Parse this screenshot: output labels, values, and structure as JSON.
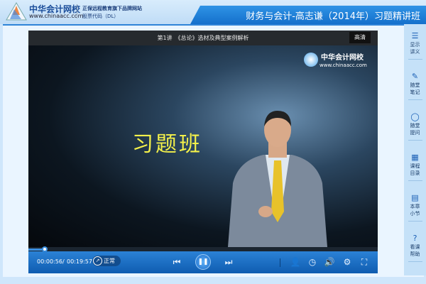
{
  "header": {
    "brand": "中华会计网校",
    "brand_url": "www.chinaacc.com",
    "slogan": "正保远程教育旗下品牌网站",
    "stock": "股票代码（DL）",
    "course_title": "财务与会计-高志谦（2014年）习题精讲班"
  },
  "video": {
    "lecture_title": "第1讲　《总论》选材及典型案例解析",
    "quality": "高清",
    "logo_text": "中华会计网校",
    "logo_url": "www.chinaacc.com",
    "slide_text": "习题班",
    "progress_fraction": 0.047
  },
  "controls": {
    "current_time": "00:00:56",
    "separator": "/",
    "total_time": "00:19:57",
    "speed": "正常"
  },
  "sidebar": {
    "items": [
      {
        "icon": "menu-icon",
        "l1": "显示",
        "l2": "讲义"
      },
      {
        "icon": "pencil-icon",
        "l1": "随堂",
        "l2": "笔记"
      },
      {
        "icon": "speech-bubble-icon",
        "l1": "随堂",
        "l2": "提问"
      },
      {
        "icon": "grid-icon",
        "l1": "课程",
        "l2": "目录"
      },
      {
        "icon": "document-icon",
        "l1": "本章",
        "l2": "小节"
      },
      {
        "icon": "help-icon",
        "l1": "看课",
        "l2": "帮助"
      }
    ]
  },
  "colors": {
    "accent": "#1570cc",
    "slide_text": "#f4f14a"
  }
}
